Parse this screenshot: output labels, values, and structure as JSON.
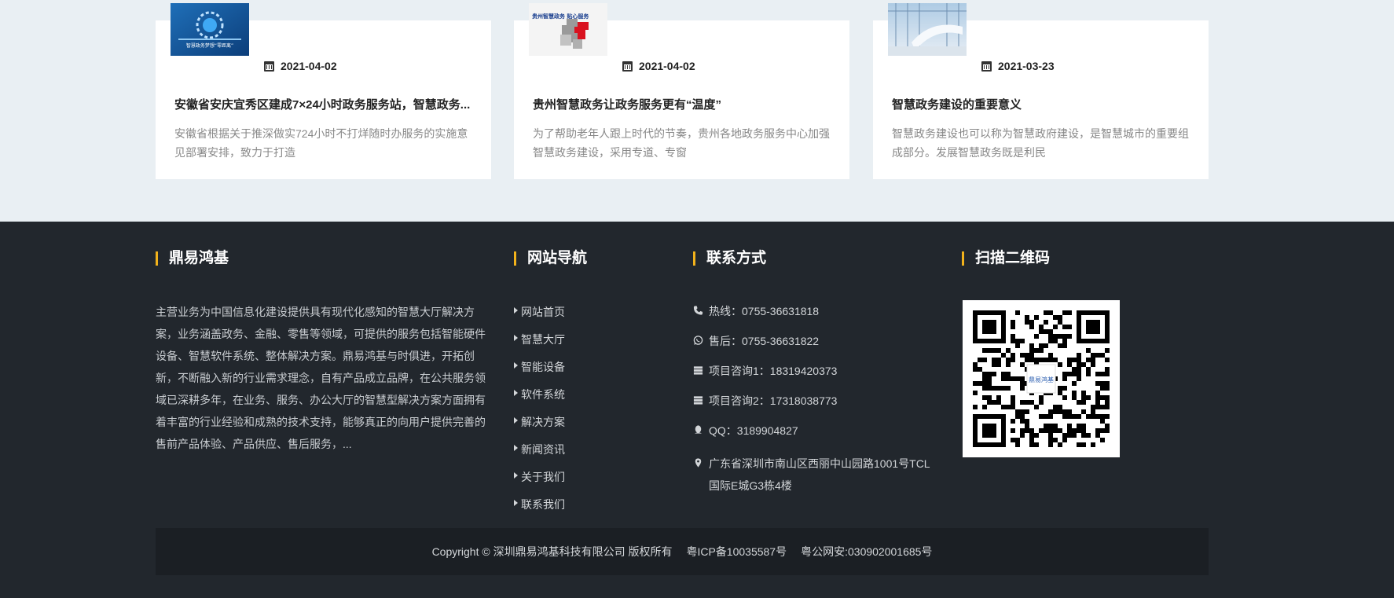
{
  "news": [
    {
      "date": "2021-04-02",
      "title": "安徽省安庆宜秀区建成7×24小时政务服务站，智慧政务...",
      "desc": "安徽省根据关于推深做实724小时不打烊随时办服务的实施意见部署安排，致力于打造",
      "thumb_caption": "智慧政务梦想“零距离”"
    },
    {
      "date": "2021-04-02",
      "title": "贵州智慧政务让政务服务更有“温度”",
      "desc": "为了帮助老年人跟上时代的节奏，贵州各地政务服务中心加强智慧政务建设，采用专道、专窗",
      "thumb_caption": "贵州智慧政务 贴心服务"
    },
    {
      "date": "2021-03-23",
      "title": "智慧政务建设的重要意义",
      "desc": "智慧政务建设也可以称为智慧政府建设，是智慧城市的重要组成部分。发展智慧政务既是利民",
      "thumb_caption": ""
    }
  ],
  "footer": {
    "about_title": "鼎易鸿基",
    "about_text": "主营业务为中国信息化建设提供具有现代化感知的智慧大厅解决方案，业务涵盖政务、金融、零售等领域，可提供的服务包括智能硬件设备、智慧软件系统、整体解决方案。鼎易鸿基与时俱进，开拓创新，不断融入新的行业需求理念，自有产品成立品牌，在公共服务领域已深耕多年，在业务、服务、办公大厅的智慧型解决方案方面拥有着丰富的行业经验和成熟的技术支持，能够真正的向用户提供完善的售前产品体验、产品供应、售后服务，...",
    "nav_title": "网站导航",
    "nav_items": [
      "网站首页",
      "智慧大厅",
      "智能设备",
      "软件系统",
      "解决方案",
      "新闻资讯",
      "关于我们",
      "联系我们"
    ],
    "contact_title": "联系方式",
    "contact": {
      "hotline": "热线：0755-36631818",
      "aftersale": "售后：0755-36631822",
      "consult1": "项目咨询1：18319420373",
      "consult2": "项目咨询2：17318038773",
      "qq": "QQ：3189904827",
      "address": "广东省深圳市南山区西丽中山园路1001号TCL国际E城G3栋4楼"
    },
    "qr_title": "扫描二维码",
    "qr_logo_text": "鼎易鸿基",
    "copyright": "Copyright © 深圳鼎易鸿基科技有限公司 版权所有",
    "icp": "粤ICP备10035587号",
    "police": "粤公网安:030902001685号"
  },
  "colors": {
    "accent": "#f2b21b",
    "footer_bg": "#22272d",
    "copyright_bg": "#1b1f24",
    "news_bg": "#e9eff3"
  }
}
